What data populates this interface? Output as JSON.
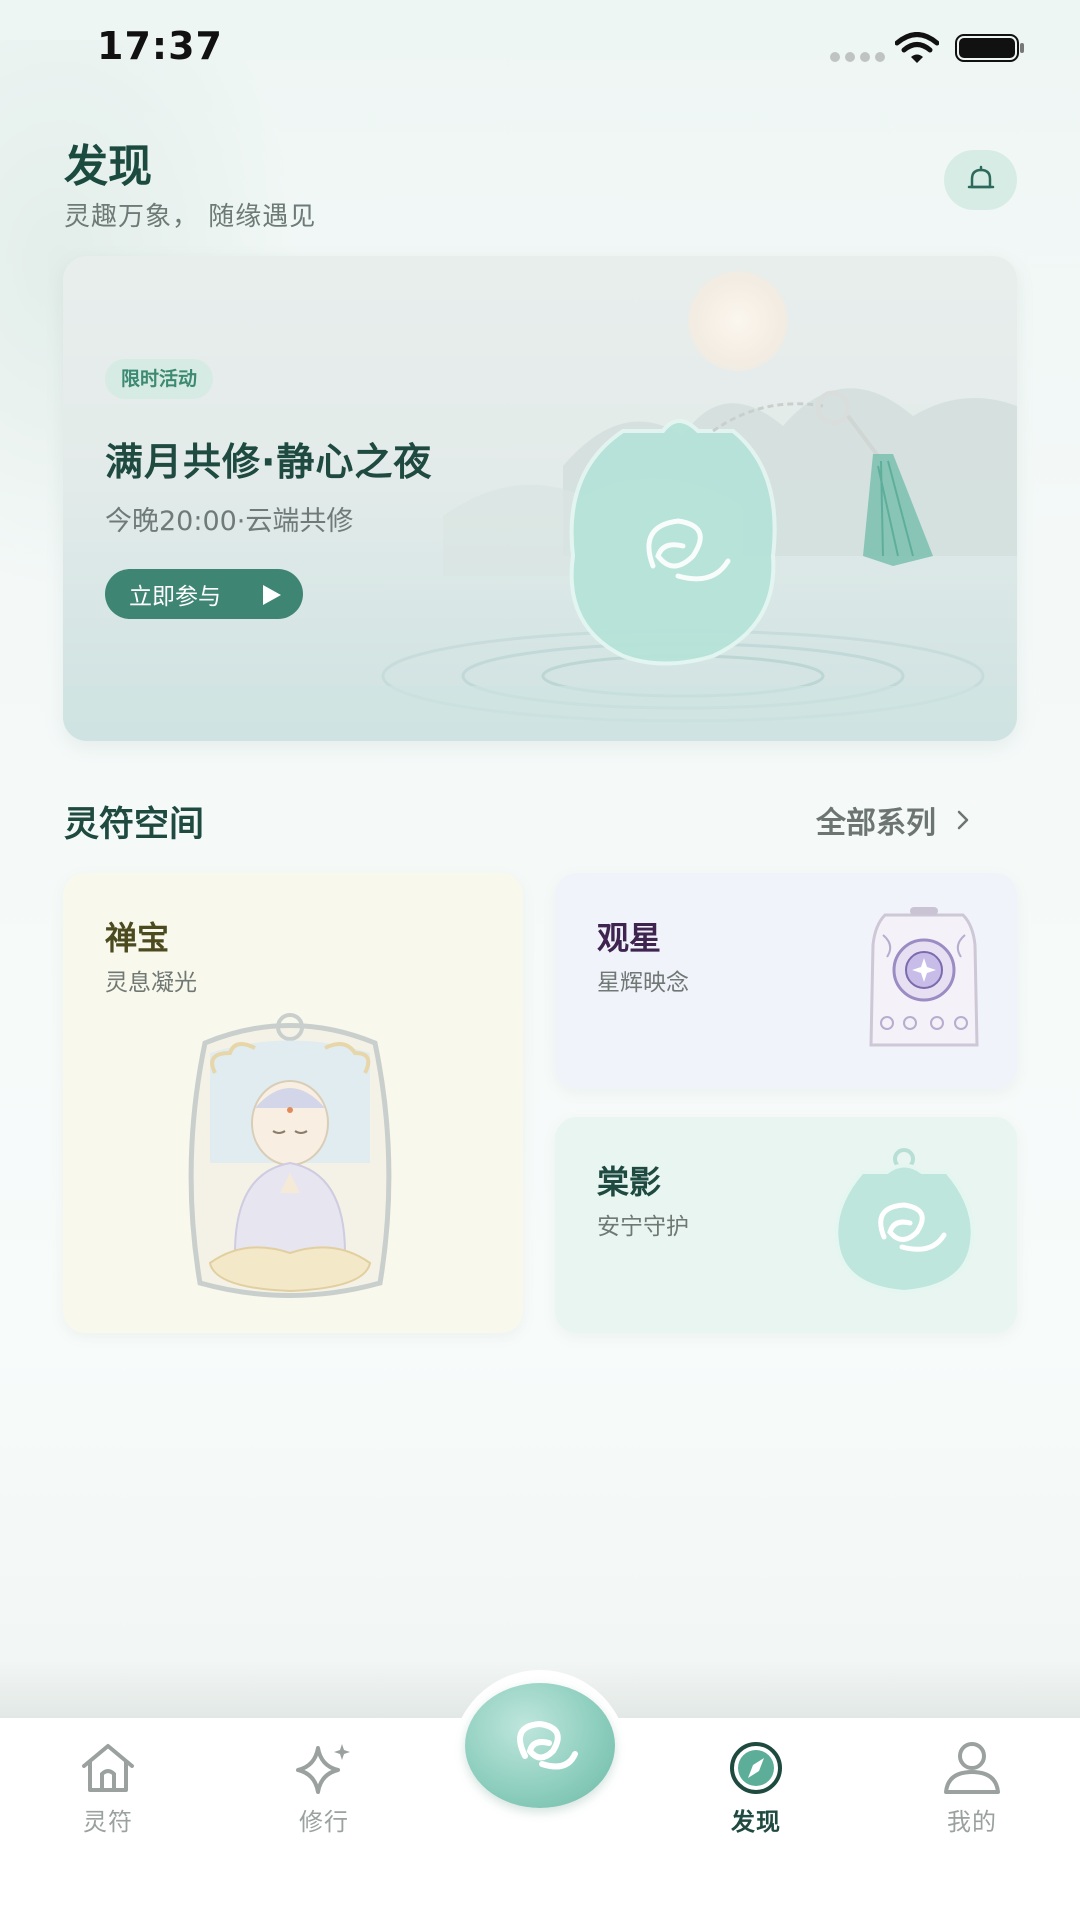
{
  "status_bar": {
    "time": "17:37"
  },
  "header": {
    "title": "发现",
    "subtitle": "灵趣万象， 随缘遇见",
    "bell_icon": "bell-icon"
  },
  "banner": {
    "tag": "限时活动",
    "title": "满月共修·静心之夜",
    "subtitle": "今晚20:00·云端共修",
    "button_label": "立即参与"
  },
  "section": {
    "title": "灵符空间",
    "more_label": "全部系列"
  },
  "cards": [
    {
      "title": "禅宝",
      "subtitle": "灵息凝光"
    },
    {
      "title": "观星",
      "subtitle": "星辉映念"
    },
    {
      "title": "棠影",
      "subtitle": "安宁守护"
    }
  ],
  "bottom_nav": {
    "items": [
      {
        "label": "灵符",
        "icon": "home-icon"
      },
      {
        "label": "修行",
        "icon": "sparkle-icon"
      },
      {
        "label": "发现",
        "icon": "compass-icon",
        "active": true
      },
      {
        "label": "我的",
        "icon": "user-icon"
      }
    ]
  },
  "colors": {
    "primary": "#3e8573",
    "title": "#1e4a40",
    "inactive_nav": "#9aa19f"
  }
}
